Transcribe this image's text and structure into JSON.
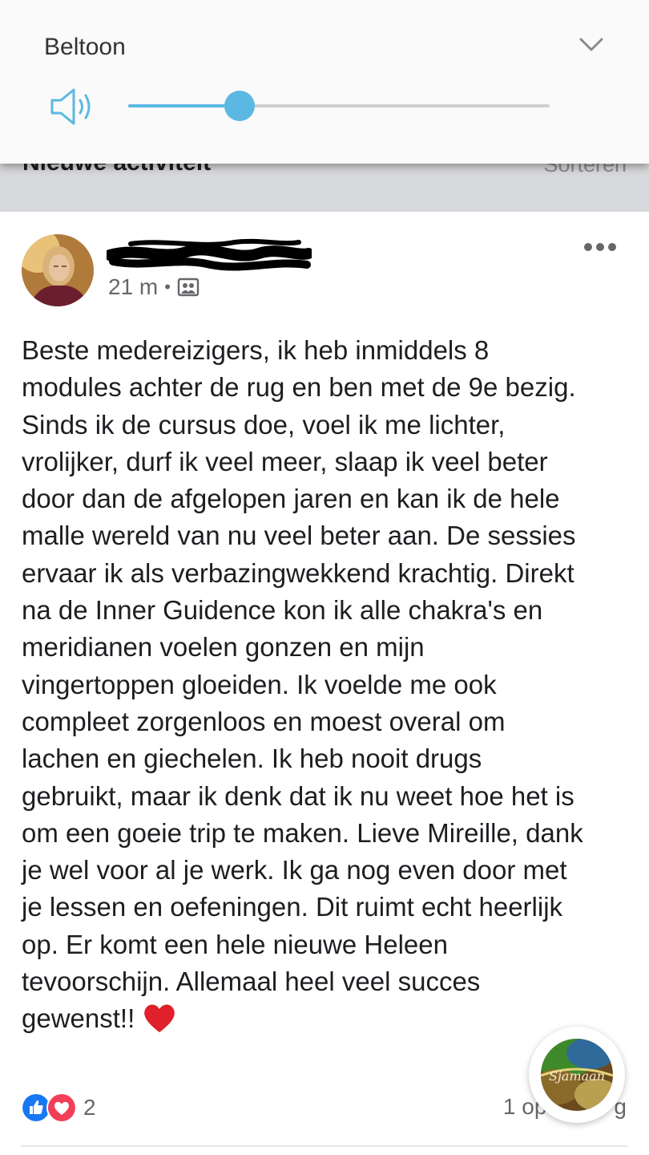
{
  "volume_panel": {
    "label": "Beltoon",
    "level_fraction": 0.265,
    "accent_color": "#5bb8e3",
    "icons": {
      "speaker": "speaker-volume-icon",
      "expand": "chevron-down-icon"
    }
  },
  "feed": {
    "section_title": "Nieuwe activiteit",
    "sort_label": "Sorteren"
  },
  "post": {
    "time": "21 m",
    "separator": "•",
    "audience_icon": "group-audience-icon",
    "text": "Beste medereizigers, ik heb inmiddels 8\nmodules achter de rug en ben met de 9e bezig.\nSinds ik de cursus doe, voel ik me lichter,\nvrolijker, durf ik veel meer, slaap ik veel beter\ndoor dan de afgelopen jaren en kan ik de hele\nmalle wereld van nu veel beter aan. De sessies\nervaar ik als verbazingwekkend krachtig. Direkt\nna de Inner Guidence kon ik alle chakra's en\nmeridianen voelen gonzen en mijn\nvingertoppen gloeiden. Ik voelde me ook\ncompleet zorgenloos en moest overal om\nlachen en giechelen. Ik heb nooit drugs\ngebruikt, maar ik denk dat ik nu weet hoe het is\nom een goeie trip te maken. Lieve Mireille, dank\nje wel voor al je werk. Ik ga nog even door met\nje lessen en oefeningen. Dit ruimt echt heerlijk\nop. Er komt een hele nieuwe Heleen\ntevoorschijn. Allemaal heel veel succes\ngewenst!!",
    "emoji": "heart-emoji",
    "reaction_count": "2",
    "share_text": "1 op",
    "share_text_tail": "g",
    "reaction_icons": [
      "like-icon",
      "love-icon"
    ]
  },
  "floating_badge": {
    "logo_text": "Sjamaan"
  }
}
